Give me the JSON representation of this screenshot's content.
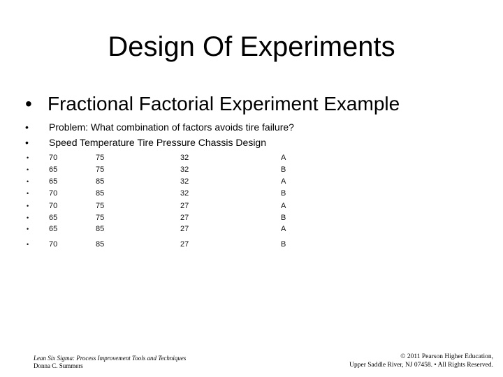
{
  "slide": {
    "title": "Design Of Experiments",
    "main_bullet": {
      "bullet": "•",
      "text": "Fractional Factorial Experiment Example"
    },
    "sub_bullets": [
      {
        "bullet": "•",
        "text": "Problem: What combination of factors avoids tire failure?"
      },
      {
        "bullet": "•",
        "text": "Speed   Temperature  Tire Pressure Chassis Design"
      }
    ],
    "table": {
      "columns": [
        "Speed",
        "Temperature",
        "Tire Pressure",
        "Chassis Design"
      ],
      "rows": [
        {
          "bullet": "•",
          "cells": [
            "70",
            "75",
            "32",
            "A"
          ]
        },
        {
          "bullet": "•",
          "cells": [
            "65",
            "75",
            "32",
            "B"
          ]
        },
        {
          "bullet": "•",
          "cells": [
            "65",
            "85",
            "32",
            "A"
          ]
        },
        {
          "bullet": "•",
          "cells": [
            "70",
            "85",
            "32",
            "B"
          ]
        },
        {
          "bullet": "•",
          "cells": [
            "70",
            "75",
            "27",
            "A"
          ]
        },
        {
          "bullet": "•",
          "cells": [
            "65",
            "75",
            "27",
            "B"
          ]
        },
        {
          "bullet": "•",
          "cells": [
            "65",
            "85",
            "27",
            "A"
          ]
        },
        {
          "bullet": "•",
          "cells": [
            "70",
            "85",
            "27",
            "B"
          ]
        }
      ]
    },
    "footer": {
      "left_line1": "Lean Six Sigma: Process Improvement Tools and Techniques",
      "left_line2": "Donna C. Summers",
      "right_line1": "© 2011 Pearson Higher Education,",
      "right_line2": "Upper Saddle River, NJ 07458. • All Rights Reserved."
    }
  }
}
